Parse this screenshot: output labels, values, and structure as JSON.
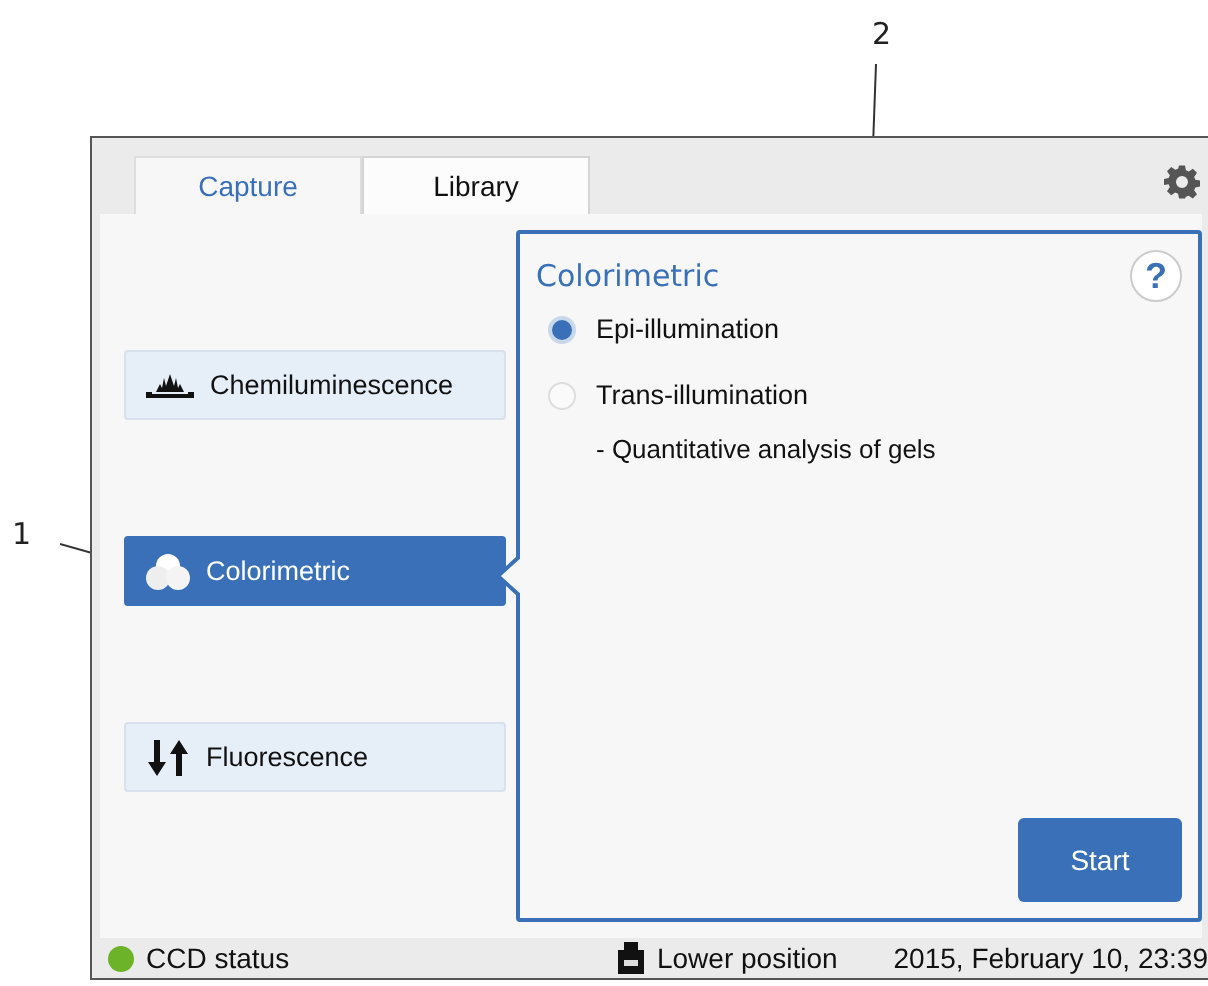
{
  "callouts": [
    {
      "label": "1",
      "kind": "left"
    },
    {
      "label": "2",
      "kind": "top"
    }
  ],
  "tabs": [
    {
      "label": "Capture",
      "selected": true
    },
    {
      "label": "Library",
      "selected": false
    }
  ],
  "modes": [
    {
      "label": "Chemiluminescence",
      "kind": "chemi",
      "selected": false
    },
    {
      "label": "Colorimetric",
      "kind": "color",
      "selected": true
    },
    {
      "label": "Fluorescence",
      "kind": "fluor",
      "selected": false
    }
  ],
  "panel": {
    "title": "Colorimetric",
    "help": "?",
    "options": [
      {
        "label": "Epi-illumination",
        "selected": true
      },
      {
        "label": "Trans-illumination",
        "selected": false
      }
    ],
    "note": "- Quantitative analysis of gels",
    "button": "Start"
  },
  "status_bar": {
    "ccd": {
      "label": "CCD status",
      "color": "#6db32a"
    },
    "position": "Lower position",
    "datetime": "2015, February 10, 23:39"
  }
}
